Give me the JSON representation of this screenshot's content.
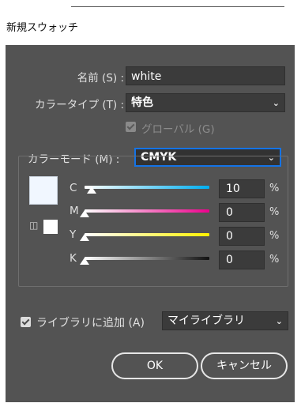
{
  "window": {
    "title": "新規スウォッチ"
  },
  "name_row": {
    "label": "名前 (S) :",
    "value": "white"
  },
  "colortype_row": {
    "label": "カラータイプ (T) :",
    "value": "特色"
  },
  "global": {
    "label": "グローバル (G)",
    "checked": true,
    "enabled": false
  },
  "colormode_row": {
    "label": "カラーモード (M) :",
    "value": "CMYK"
  },
  "channels": [
    {
      "letter": "C",
      "value": "10",
      "unit": "%",
      "fraction": 0.1
    },
    {
      "letter": "M",
      "value": "0",
      "unit": "%",
      "fraction": 0.0
    },
    {
      "letter": "Y",
      "value": "0",
      "unit": "%",
      "fraction": 0.0
    },
    {
      "letter": "K",
      "value": "0",
      "unit": "%",
      "fraction": 0.0
    }
  ],
  "library": {
    "label": "ライブラリに追加 (A)",
    "checked": true,
    "select_value": "マイライブラリ"
  },
  "buttons": {
    "ok": "OK",
    "cancel": "キャンセル"
  },
  "colors": {
    "dialog_bg": "#535353",
    "accent": "#1473e6",
    "swatch": "#f1f7ff"
  },
  "icons": {
    "dropdown": "chevron-down-icon",
    "cube": "cube-icon"
  }
}
